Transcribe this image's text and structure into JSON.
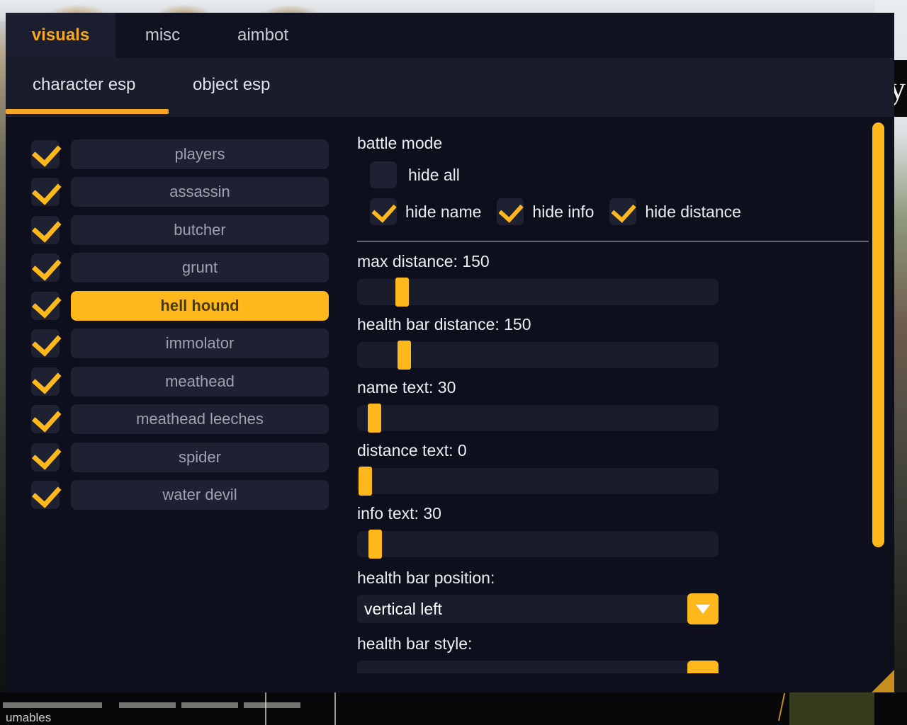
{
  "window": {
    "tabs": [
      {
        "label": "visuals",
        "active": true
      },
      {
        "label": "misc",
        "active": false
      },
      {
        "label": "aimbot",
        "active": false
      }
    ],
    "subtabs": [
      {
        "label": "character esp",
        "active": true
      },
      {
        "label": "object esp",
        "active": false
      }
    ],
    "accent_color": "#ffb81c",
    "panel_color": "#0d0f1c"
  },
  "entity_list": {
    "items": [
      {
        "label": "players",
        "checked": true,
        "selected": false
      },
      {
        "label": "assassin",
        "checked": true,
        "selected": false
      },
      {
        "label": "butcher",
        "checked": true,
        "selected": false
      },
      {
        "label": "grunt",
        "checked": true,
        "selected": false
      },
      {
        "label": "hell hound",
        "checked": true,
        "selected": true
      },
      {
        "label": "immolator",
        "checked": true,
        "selected": false
      },
      {
        "label": "meathead",
        "checked": true,
        "selected": false
      },
      {
        "label": "meathead leeches",
        "checked": true,
        "selected": false
      },
      {
        "label": "spider",
        "checked": true,
        "selected": false
      },
      {
        "label": "water devil",
        "checked": true,
        "selected": false
      }
    ]
  },
  "battle_mode": {
    "title": "battle mode",
    "hide_all": {
      "label": "hide all",
      "checked": false
    },
    "flags": [
      {
        "label": "hide name",
        "checked": true
      },
      {
        "label": "hide info",
        "checked": true
      },
      {
        "label": "hide distance",
        "checked": true
      }
    ]
  },
  "sliders": [
    {
      "label": "max distance: 150",
      "name": "max distance",
      "value": 150,
      "fill_percent": 10.6
    },
    {
      "label": "health bar distance: 150",
      "name": "health bar distance",
      "value": 150,
      "fill_percent": 11.2
    },
    {
      "label": "name text: 30",
      "name": "name text",
      "value": 30,
      "fill_percent": 3.0
    },
    {
      "label": "distance text: 0",
      "name": "distance text",
      "value": 0,
      "fill_percent": 0.4
    },
    {
      "label": "info text: 30",
      "name": "info text",
      "value": 30,
      "fill_percent": 3.2
    }
  ],
  "dropdowns": [
    {
      "label": "health bar position:",
      "value": "vertical left",
      "arrow": "chevron-down-icon"
    },
    {
      "label": "health bar style:",
      "value": "",
      "arrow": "chevron-down-icon"
    }
  ],
  "scrollbar": {
    "name": "vertical-scrollbar"
  },
  "background": {
    "hud_text": "umables"
  }
}
